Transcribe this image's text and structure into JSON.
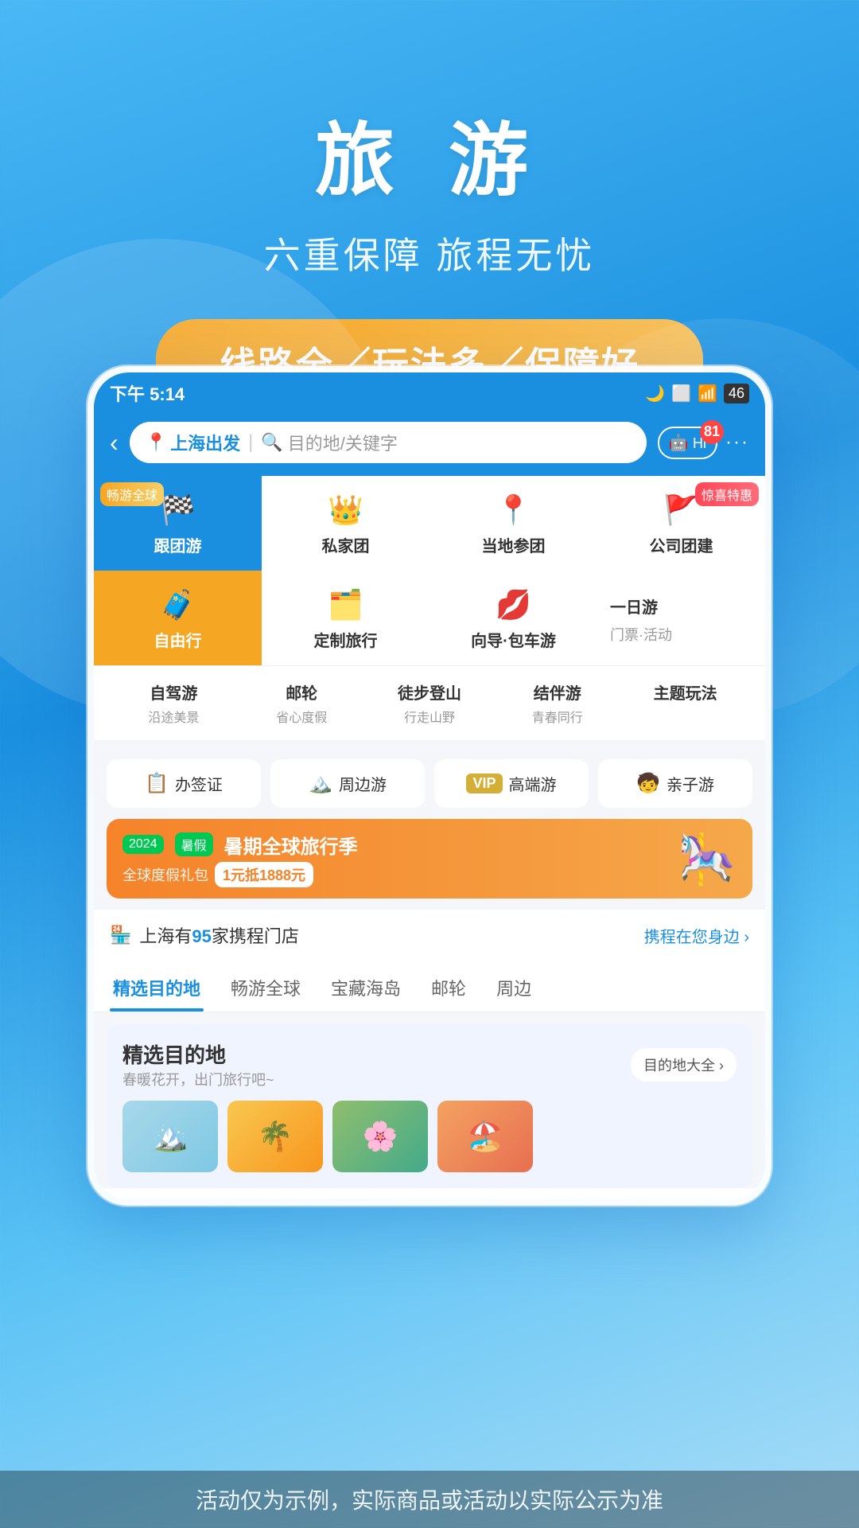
{
  "header": {
    "title": "旅 游",
    "subtitle": "六重保障 旅程无忧",
    "promo": "线路全／玩法多／保障好"
  },
  "statusBar": {
    "time": "下午 5:14",
    "moonIcon": "🌙",
    "wifiIcon": "WiFi",
    "batteryIcon": "46"
  },
  "appHeader": {
    "backLabel": "‹",
    "searchFrom": "上海出发",
    "searchFromIcon": "📍",
    "searchPlaceholder": "目的地/关键字",
    "searchIcon": "🔍",
    "hiBadge": "Hi",
    "notifCount": "81",
    "moreDots": "···"
  },
  "categories": {
    "row1": [
      {
        "id": "group-tour",
        "label": "跟团游",
        "icon": "🏁",
        "badge": "畅游全球",
        "bg": "blue"
      },
      {
        "id": "private-tour",
        "label": "私家团",
        "icon": "👑",
        "badge": "",
        "bg": "white"
      },
      {
        "id": "local-tour",
        "label": "当地参团",
        "icon": "📍",
        "badge": "",
        "bg": "white"
      },
      {
        "id": "company-tour",
        "label": "公司团建",
        "icon": "🚩",
        "badge": "惊喜特惠",
        "bg": "white"
      }
    ],
    "row2": [
      {
        "id": "free-tour",
        "label": "自由行",
        "icon": "🧳",
        "badge": "",
        "bg": "orange"
      },
      {
        "id": "custom-tour",
        "label": "定制旅行",
        "icon": "🗂️",
        "badge": "",
        "bg": "white"
      },
      {
        "id": "guide-tour",
        "label": "向导·包车游",
        "icon": "💋",
        "badge": "",
        "bg": "white"
      },
      {
        "id": "day-tour",
        "label": "一日游\n门票·活动",
        "icon": "",
        "badge": "",
        "bg": "white"
      }
    ],
    "row3": [
      {
        "id": "self-drive",
        "title": "自驾游",
        "sub": "沿途美景"
      },
      {
        "id": "cruise",
        "title": "邮轮",
        "sub": "省心度假"
      },
      {
        "id": "hiking",
        "title": "徒步登山",
        "sub": "行走山野"
      },
      {
        "id": "companion",
        "title": "结伴游",
        "sub": "青春同行"
      },
      {
        "id": "theme",
        "title": "主题玩法",
        "sub": ""
      }
    ]
  },
  "services": [
    {
      "id": "visa",
      "label": "办签证",
      "icon": "📋"
    },
    {
      "id": "nearby",
      "label": "周边游",
      "icon": "🏔️"
    },
    {
      "id": "premium",
      "label": "高端游",
      "icon": "VIP",
      "isText": true
    },
    {
      "id": "family",
      "label": "亲子游",
      "icon": "🧒"
    }
  ],
  "promoBanner": {
    "badge1": "2024",
    "badge2": "暑假",
    "mainText": "暑期全球旅行季",
    "subText": "全球度假礼包",
    "highlight": "1元抵1888元"
  },
  "storeInfo": {
    "icon": "🏪",
    "prefix": "上海有",
    "highlight": "95",
    "suffix": "家携程门店",
    "link": "携程在您身边 ›"
  },
  "tabs": [
    {
      "id": "selected",
      "label": "精选目的地",
      "active": true
    },
    {
      "id": "global",
      "label": "畅游全球",
      "active": false
    },
    {
      "id": "island",
      "label": "宝藏海岛",
      "active": false
    },
    {
      "id": "cruise-tab",
      "label": "邮轮",
      "active": false
    },
    {
      "id": "nearby-tab",
      "label": "周边",
      "active": false
    }
  ],
  "destinationSection": {
    "title": "精选目的地",
    "subtitle": "春暖花开，出门旅行吧~",
    "linkText": "目的地大全 ›"
  },
  "disclaimer": {
    "text": "活动仅为示例，实际商品或活动以实际公示为准"
  },
  "aiBadge": {
    "label": "Ai"
  }
}
